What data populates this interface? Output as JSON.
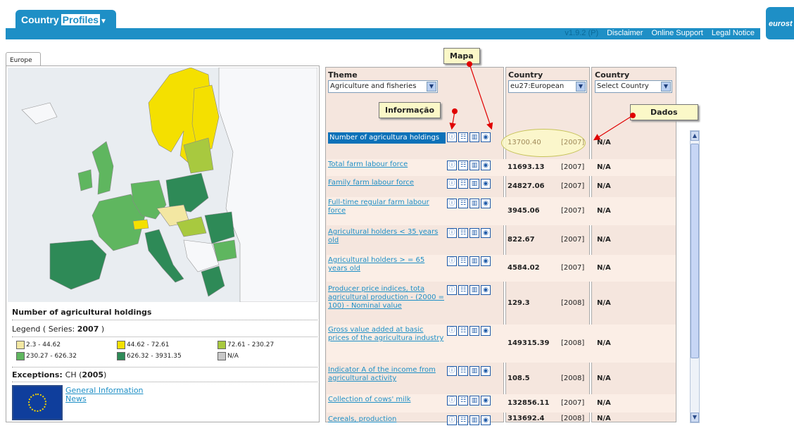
{
  "header": {
    "app_title_part1": "Country",
    "app_title_part2": "Profiles",
    "version": "v1.9.2 (P)",
    "links": [
      "Disclaimer",
      "Online Support",
      "Legal Notice"
    ],
    "logo_text": "eurost"
  },
  "left": {
    "tab_label": "Europe",
    "map_title": "Number of agricultural holdings",
    "legend_prefix": "Legend ( Series: ",
    "legend_series": "2007",
    "legend_suffix": " )",
    "legend": [
      {
        "label": "2.3 - 44.62",
        "color": "#f3e7a2"
      },
      {
        "label": "44.62 - 72.61",
        "color": "#f4e000"
      },
      {
        "label": "72.61 - 230.27",
        "color": "#a8c93f"
      },
      {
        "label": "230.27 - 626.32",
        "color": "#5fb65f"
      },
      {
        "label": "626.32 - 3931.35",
        "color": "#2e8a57"
      },
      {
        "label": "N/A",
        "color": "#c8c8c8"
      }
    ],
    "exceptions_label": "Exceptions: ",
    "exceptions_code": "CH (",
    "exceptions_year": "2005",
    "exceptions_close": ")",
    "links": [
      "General Information",
      "News"
    ]
  },
  "columns": {
    "theme_header": "Theme",
    "theme_value": "Agriculture and fisheries",
    "country1_header": "Country",
    "country1_value": "eu27:European",
    "country2_header": "Country",
    "country2_value": "Select Country"
  },
  "rows": [
    {
      "indicator": "Number of agricultura holdings",
      "value": "13700.40",
      "year": "[2007]",
      "country2": "N/A"
    },
    {
      "indicator": "Total farm labour force",
      "value": "11693.13",
      "year": "[2007]",
      "country2": "N/A"
    },
    {
      "indicator": "Family farm labour force",
      "value": "24827.06",
      "year": "[2007]",
      "country2": "N/A"
    },
    {
      "indicator": "Full-time regular farm labour force",
      "value": "3945.06",
      "year": "[2007]",
      "country2": "N/A"
    },
    {
      "indicator": "Agricultural holders < 35 years old",
      "value": "822.67",
      "year": "[2007]",
      "country2": "N/A"
    },
    {
      "indicator": "Agricultural holders > = 65 years old",
      "value": "4584.02",
      "year": "[2007]",
      "country2": "N/A"
    },
    {
      "indicator": "Producer price indices, tota agricultural production - (2000 = 100) - Nominal value",
      "value": "129.3",
      "year": "[2008]",
      "country2": "N/A"
    },
    {
      "indicator": "Gross value added at basic prices of the agricultura industry",
      "value": "149315.39",
      "year": "[2008]",
      "country2": "N/A"
    },
    {
      "indicator": "Indicator A of the income from agricultural activity",
      "value": "108.5",
      "year": "[2008]",
      "country2": "N/A"
    },
    {
      "indicator": "Collection of cows' milk",
      "value": "132856.11",
      "year": "[2007]",
      "country2": "N/A"
    },
    {
      "indicator": "Cereals, production",
      "value": "313692.4",
      "year": "[2008]",
      "country2": "N/A"
    }
  ],
  "icons": [
    "info-icon",
    "table-icon",
    "chart-icon",
    "map-icon"
  ],
  "callouts": {
    "map": "Mapa",
    "info": "Informação",
    "data": "Dados"
  }
}
